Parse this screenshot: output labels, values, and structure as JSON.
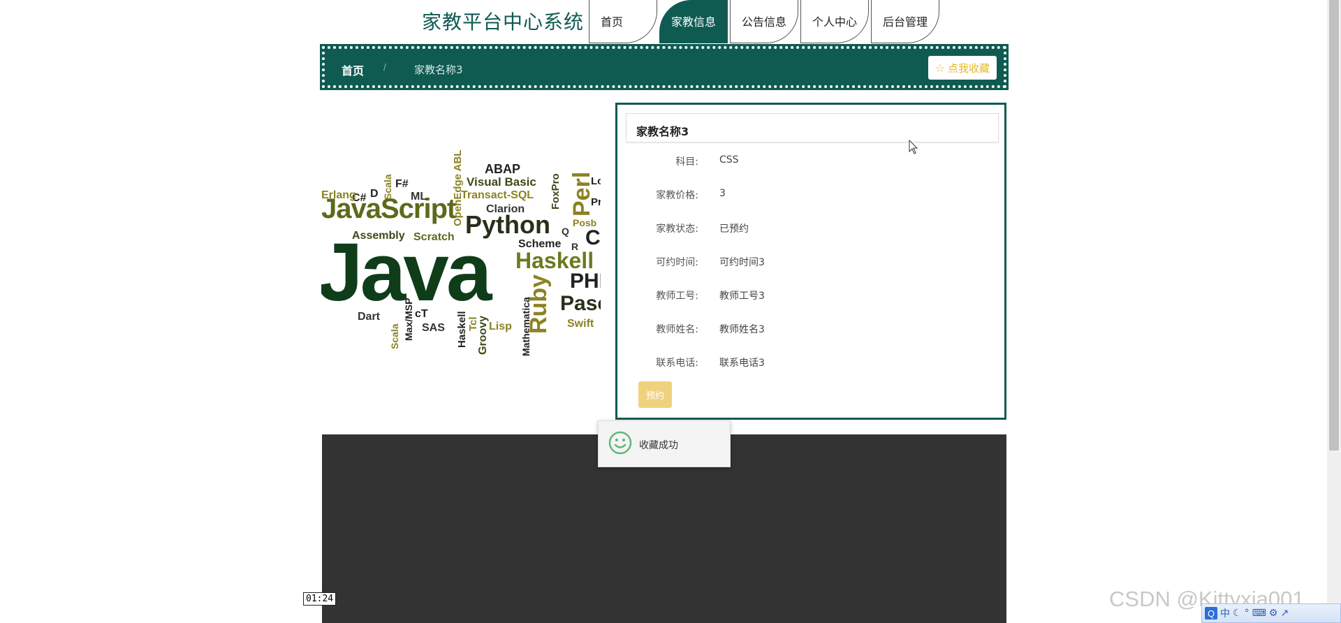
{
  "header": {
    "brand": "家教平台中心系统",
    "nav": [
      {
        "label": "首页",
        "active": false
      },
      {
        "label": "家教信息",
        "active": true
      },
      {
        "label": "公告信息",
        "active": false
      },
      {
        "label": "个人中心",
        "active": false
      },
      {
        "label": "后台管理",
        "active": false
      }
    ]
  },
  "breadcrumb": {
    "home": "首页",
    "separator": "/",
    "current": "家教名称3",
    "favorite_label": "点我收藏"
  },
  "word_cloud": {
    "words": [
      "Java",
      "JavaScript",
      "Python",
      "Haskell",
      "Ruby",
      "Perl",
      "ABAP",
      "Visual Basic",
      "Transact-SQL",
      "Clarion",
      "OpenEdge ABL",
      "FoxPro",
      "Scala",
      "F#",
      "ML",
      "C#",
      "D",
      "Erlang",
      "Assembly",
      "Scratch",
      "Scheme",
      "R",
      "Q",
      "PHP",
      "Pascal",
      "Swift",
      "Mathematica",
      "Lisp",
      "Groovy",
      "Tcl",
      "Haskell",
      "SAS",
      "cT",
      "Max/MSP",
      "Dart",
      "Scala",
      "Posb",
      "C",
      "Lo",
      "Pr"
    ]
  },
  "detail": {
    "title": "家教名称3",
    "fields": [
      {
        "label": "科目:",
        "value": "CSS"
      },
      {
        "label": "家教价格:",
        "value": "3"
      },
      {
        "label": "家教状态:",
        "value": "已预约"
      },
      {
        "label": "可约时间:",
        "value": "可约时间3"
      },
      {
        "label": "教师工号:",
        "value": "教师工号3"
      },
      {
        "label": "教师姓名:",
        "value": "教师姓名3"
      },
      {
        "label": "联系电话:",
        "value": "联系电话3"
      }
    ],
    "book_label": "预约"
  },
  "toast": {
    "message": "收藏成功"
  },
  "video": {
    "timestamp": "01:24"
  },
  "watermark": "CSDN @Kittyxia001",
  "tray": {
    "logo": "Q",
    "ime": "中"
  },
  "colors": {
    "primary": "#0f5b52",
    "accent": "#e6b82c",
    "footer": "#333333"
  }
}
